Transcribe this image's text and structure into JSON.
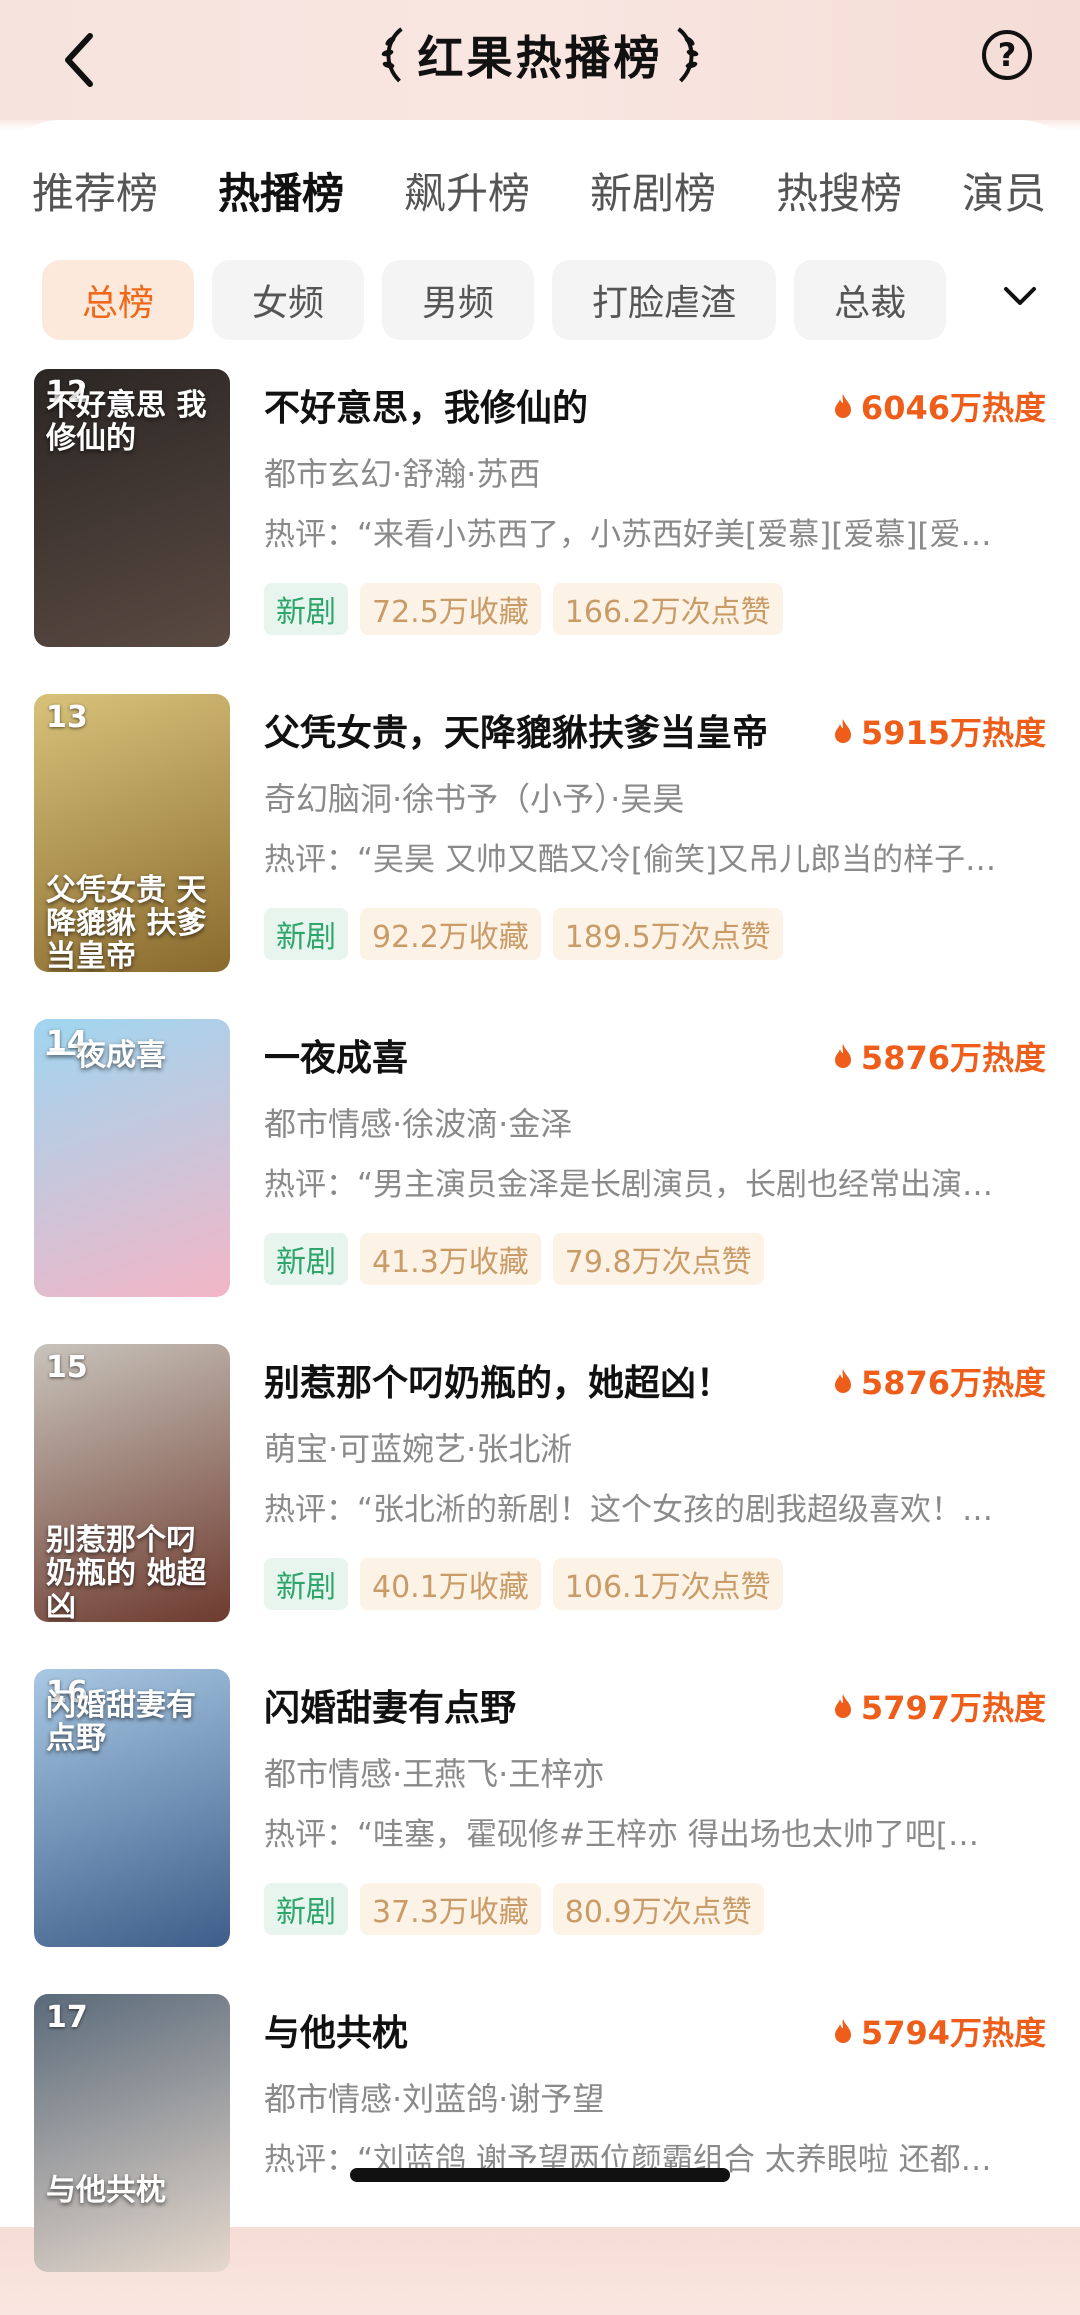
{
  "header": {
    "title": "红果热播榜",
    "help_label": "?"
  },
  "tabs": [
    "推荐榜",
    "热播榜",
    "飙升榜",
    "新剧榜",
    "热搜榜",
    "演员"
  ],
  "active_tab": "热播榜",
  "chips": [
    "总榜",
    "女频",
    "男频",
    "打脸虐渣",
    "总裁"
  ],
  "active_chip": "总榜",
  "items": [
    {
      "rank": "12",
      "title": "不好意思，我修仙的",
      "heat": "6046万热度",
      "meta": "都市玄幻·舒瀚·苏西",
      "comment": "热评：“来看小苏西了，小苏西好美[爱慕][爱慕][爱…",
      "badge_new": "新剧",
      "favorites": "72.5万收藏",
      "likes": "166.2万次点赞",
      "poster_text": "不好意思 我修仙的",
      "poster_colors": [
        "#2b2624",
        "#5a4a42"
      ]
    },
    {
      "rank": "13",
      "title": "父凭女贵，天降貔貅扶爹当皇帝",
      "heat": "5915万热度",
      "meta": "奇幻脑洞·徐书予（小予）·吴昊",
      "comment": "热评：“吴昊 又帅又酷又冷[偷笑]又吊儿郎当的样子…",
      "badge_new": "新剧",
      "favorites": "92.2万收藏",
      "likes": "189.5万次点赞",
      "poster_text": "父凭女贵 天降貔貅 扶爹当皇帝",
      "poster_colors": [
        "#d8c27a",
        "#8a6a2e"
      ]
    },
    {
      "rank": "14",
      "title": "一夜成喜",
      "heat": "5876万热度",
      "meta": "都市情感·徐波滴·金泽",
      "comment": "热评：“男主演员金泽是长剧演员，长剧也经常出演…",
      "badge_new": "新剧",
      "favorites": "41.3万收藏",
      "likes": "79.8万次点赞",
      "poster_text": "一夜成喜",
      "poster_colors": [
        "#9fd6f0",
        "#f3b6c6"
      ]
    },
    {
      "rank": "15",
      "title": "别惹那个叼奶瓶的，她超凶！",
      "heat": "5876万热度",
      "meta": "萌宝·可蓝婉艺·张北淅",
      "comment": "热评：“张北淅的新剧！这个女孩的剧我超级喜欢！…",
      "badge_new": "新剧",
      "favorites": "40.1万收藏",
      "likes": "106.1万次点赞",
      "poster_text": "别惹那个叼奶瓶的 她超凶",
      "poster_colors": [
        "#c8c4bc",
        "#6e3a2e"
      ]
    },
    {
      "rank": "16",
      "title": "闪婚甜妻有点野",
      "heat": "5797万热度",
      "meta": "都市情感·王燕飞·王梓亦",
      "comment": "热评：“哇塞，霍砚修#王梓亦 得出场也太帅了吧[…",
      "badge_new": "新剧",
      "favorites": "37.3万收藏",
      "likes": "80.9万次点赞",
      "poster_text": "闪婚甜妻有点野",
      "poster_colors": [
        "#a8c8e4",
        "#3e5e8a"
      ]
    },
    {
      "rank": "17",
      "title": "与他共枕",
      "heat": "5794万热度",
      "meta": "都市情感·刘蓝鸽·谢予望",
      "comment": "热评：“刘蓝鸽 谢予望两位颜霸组合 太养眼啦 还都…",
      "badge_new": "",
      "favorites": "",
      "likes": "",
      "poster_text": "与他共枕",
      "poster_colors": [
        "#5a6a7a",
        "#e6d8cc"
      ]
    }
  ],
  "colors": {
    "accent": "#ee6a1a",
    "heat": "#ee5e1a",
    "new_badge_text": "#2ea56b",
    "stat_badge_text": "#c89b67"
  }
}
